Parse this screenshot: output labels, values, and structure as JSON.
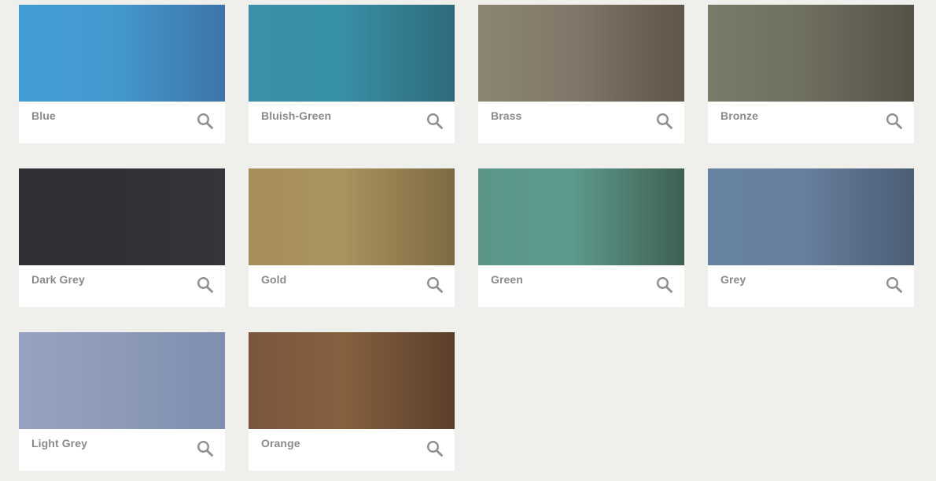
{
  "colors": {
    "background": "#efefeb",
    "card": "#ffffff",
    "label": "#8a8a8a",
    "icon": "#8f8f8f"
  },
  "swatches": [
    {
      "label": "Blue",
      "gradient": [
        "#449cd4",
        "#4499cf",
        "#3d75a8"
      ],
      "icon": "zoom-icon"
    },
    {
      "label": "Bluish-Green",
      "gradient": [
        "#3a91a8",
        "#3890a5",
        "#2f6a7c"
      ],
      "icon": "zoom-icon"
    },
    {
      "label": "Brass",
      "gradient": [
        "#8c8572",
        "#82786a",
        "#605648"
      ],
      "icon": "zoom-icon"
    },
    {
      "label": "Bronze",
      "gradient": [
        "#7a7a69",
        "#707060",
        "#545246"
      ],
      "icon": "zoom-icon"
    },
    {
      "label": "Dark Grey",
      "gradient": [
        "#303036",
        "#313037",
        "#363539"
      ],
      "icon": "zoom-icon"
    },
    {
      "label": "Gold",
      "gradient": [
        "#a78d5c",
        "#a8945f",
        "#7d6a42"
      ],
      "icon": "zoom-icon"
    },
    {
      "label": "Green",
      "gradient": [
        "#5a9588",
        "#5d9a8d",
        "#3f6053"
      ],
      "icon": "zoom-icon"
    },
    {
      "label": "Grey",
      "gradient": [
        "#6882a2",
        "#6880a0",
        "#4b5d74"
      ],
      "icon": "zoom-icon"
    },
    {
      "label": "Light Grey",
      "gradient": [
        "#97a2c1",
        "#8d9ab8",
        "#7f8eb1"
      ],
      "icon": "zoom-icon"
    },
    {
      "label": "Orange",
      "gradient": [
        "#7a563d",
        "#87603f",
        "#5a3e2a"
      ],
      "icon": "zoom-icon"
    }
  ]
}
